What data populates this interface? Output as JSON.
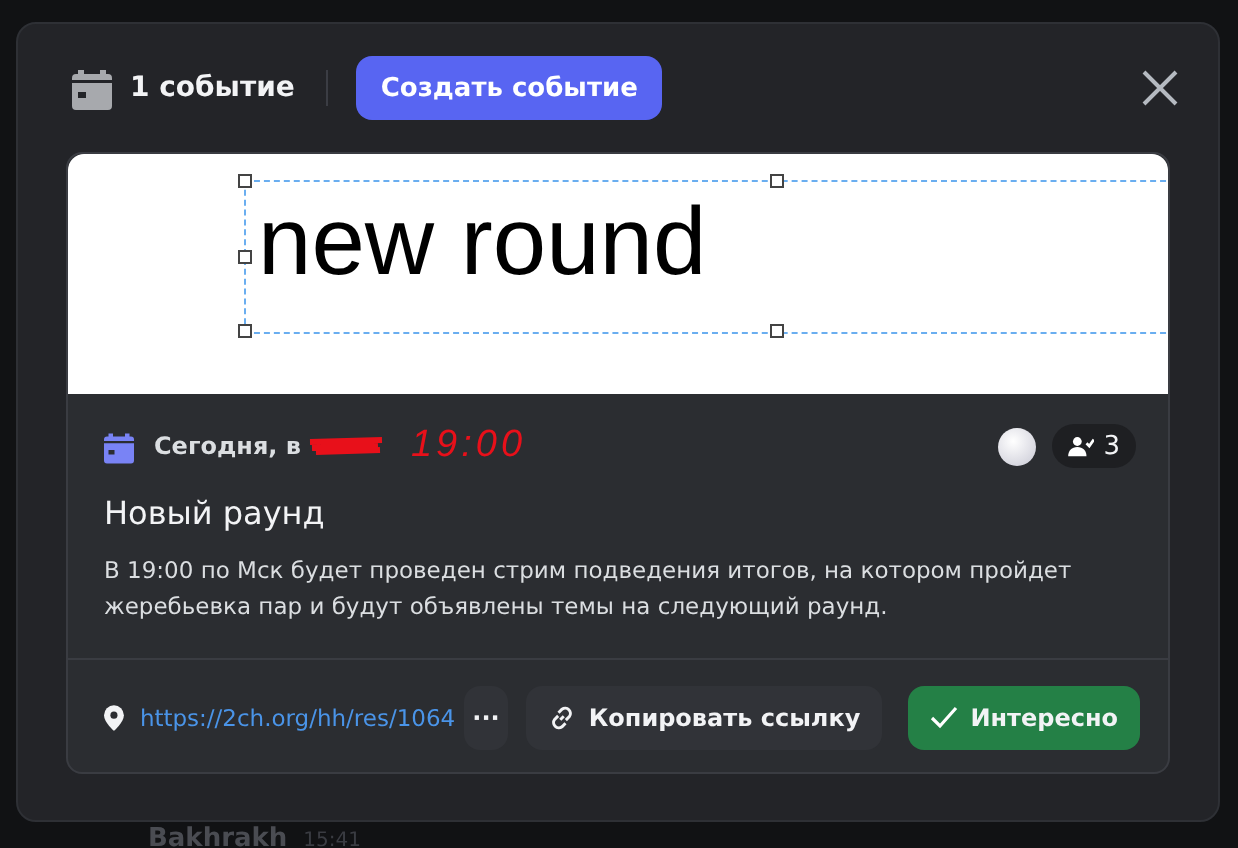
{
  "header": {
    "count": "1 событие",
    "create_button": "Создать событие"
  },
  "event": {
    "cover_text": "new round",
    "date": "Сегодня, в",
    "handwritten_time": "19:00",
    "interested_count": "3",
    "title": "Новый раунд",
    "description": "В 19:00 по Мск будет проведен стрим подведения итогов, на котором пройдет жеребьевка пар и будут объявлены темы на следующий раунд.",
    "location": "https://2ch.org/hh/res/1064",
    "more_button": "···",
    "copy_button": "Копировать ссылку",
    "interested_button": "Интересно",
    "interested": true
  },
  "background_message": {
    "author": "Bakhrakh",
    "time": "15:41"
  }
}
